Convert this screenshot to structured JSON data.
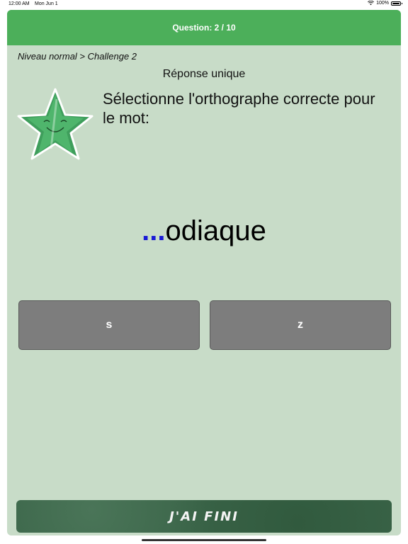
{
  "status_bar": {
    "time": "12:00 AM",
    "date": "Mon Jun 1",
    "battery": "100%"
  },
  "header": {
    "title": "Question: 2 / 10"
  },
  "breadcrumb": "Niveau normal > Challenge 2",
  "answer_type": "Réponse unique",
  "prompt": "Sélectionne l'orthographe correcte pour le mot:",
  "word": {
    "blank": "...",
    "rest": "odiaque"
  },
  "choices": [
    {
      "label": "s"
    },
    {
      "label": "z"
    }
  ],
  "finish_button": {
    "label": "J'AI FINI"
  },
  "colors": {
    "header": "#4caf5a",
    "card": "#c8dcc8",
    "choice": "#7d7d7d",
    "blank": "#1a1ad6",
    "finish": "#3a6448"
  },
  "icons": {
    "star": "smiling-star-icon",
    "wifi": "wifi-icon",
    "battery": "battery-icon"
  }
}
